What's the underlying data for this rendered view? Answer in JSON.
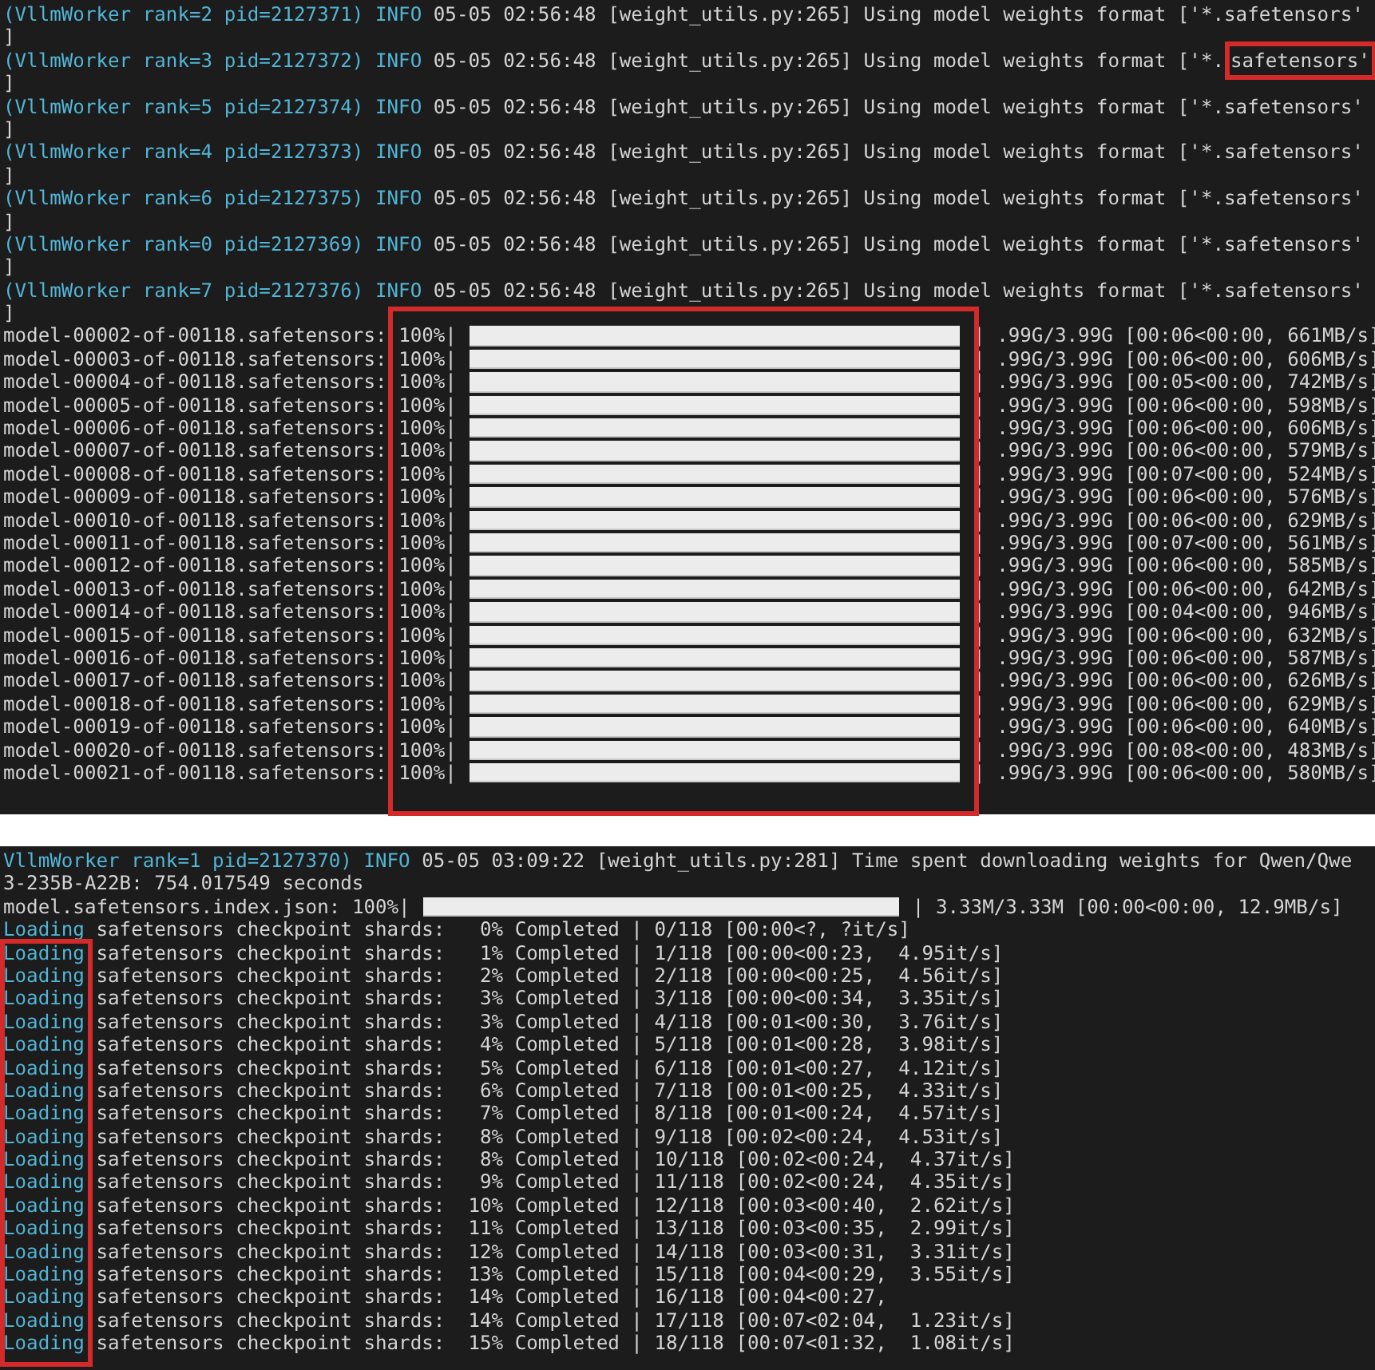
{
  "top_terminal": {
    "log_lines": [
      {
        "prefix": "(VllmWorker rank=2 pid=2127371) INFO",
        "message": "05-05 02:56:48 [weight_utils.py:265] Using model weights format ['*.safetensors'",
        "continuation": "]"
      },
      {
        "prefix": "(VllmWorker rank=3 pid=2127372) INFO",
        "message": "05-05 02:56:48 [weight_utils.py:265] Using model weights format ['*.",
        "highlight": "safetensors'",
        "continuation": "]"
      },
      {
        "prefix": "(VllmWorker rank=5 pid=2127374) INFO",
        "message": "05-05 02:56:48 [weight_utils.py:265] Using model weights format ['*.safetensors'",
        "continuation": "]"
      },
      {
        "prefix": "(VllmWorker rank=4 pid=2127373) INFO",
        "message": "05-05 02:56:48 [weight_utils.py:265] Using model weights format ['*.safetensors'",
        "continuation": "]"
      },
      {
        "prefix": "(VllmWorker rank=6 pid=2127375) INFO",
        "message": "05-05 02:56:48 [weight_utils.py:265] Using model weights format ['*.safetensors'",
        "continuation": "]"
      },
      {
        "prefix": "(VllmWorker rank=0 pid=2127369) INFO",
        "message": "05-05 02:56:48 [weight_utils.py:265] Using model weights format ['*.safetensors'",
        "continuation": "]"
      },
      {
        "prefix": "(VllmWorker rank=7 pid=2127376) INFO",
        "message": "05-05 02:56:48 [weight_utils.py:265] Using model weights format ['*.safetensors'",
        "continuation": "]"
      }
    ],
    "downloads": [
      {
        "file": "model-00002-of-00118.safetensors:",
        "percent": "100%|",
        "level": 1,
        "transfer": "| .99G/3.99G [00:06<00:00, 661MB/s]"
      },
      {
        "file": "model-00003-of-00118.safetensors:",
        "percent": "100%|",
        "level": 1,
        "transfer": "| .99G/3.99G [00:06<00:00, 606MB/s]"
      },
      {
        "file": "model-00004-of-00118.safetensors:",
        "percent": "100%|",
        "level": 1,
        "transfer": "| .99G/3.99G [00:05<00:00, 742MB/s]"
      },
      {
        "file": "model-00005-of-00118.safetensors:",
        "percent": "100%|",
        "level": 1,
        "transfer": "| .99G/3.99G [00:06<00:00, 598MB/s]"
      },
      {
        "file": "model-00006-of-00118.safetensors:",
        "percent": "100%|",
        "level": 1,
        "transfer": "| .99G/3.99G [00:06<00:00, 606MB/s]"
      },
      {
        "file": "model-00007-of-00118.safetensors:",
        "percent": "100%|",
        "level": 1,
        "transfer": "| .99G/3.99G [00:06<00:00, 579MB/s]"
      },
      {
        "file": "model-00008-of-00118.safetensors:",
        "percent": "100%|",
        "level": 1,
        "transfer": "| .99G/3.99G [00:07<00:00, 524MB/s]"
      },
      {
        "file": "model-00009-of-00118.safetensors:",
        "percent": "100%|",
        "level": 1,
        "transfer": "| .99G/3.99G [00:06<00:00, 576MB/s]"
      },
      {
        "file": "model-00010-of-00118.safetensors:",
        "percent": "100%|",
        "level": 1,
        "transfer": "| .99G/3.99G [00:06<00:00, 629MB/s]"
      },
      {
        "file": "model-00011-of-00118.safetensors:",
        "percent": "100%|",
        "level": 1,
        "transfer": "| .99G/3.99G [00:07<00:00, 561MB/s]"
      },
      {
        "file": "model-00012-of-00118.safetensors:",
        "percent": "100%|",
        "level": 1,
        "transfer": "| .99G/3.99G [00:06<00:00, 585MB/s]"
      },
      {
        "file": "model-00013-of-00118.safetensors:",
        "percent": "100%|",
        "level": 1,
        "transfer": "| .99G/3.99G [00:06<00:00, 642MB/s]"
      },
      {
        "file": "model-00014-of-00118.safetensors:",
        "percent": "100%|",
        "level": 1,
        "transfer": "| .99G/3.99G [00:04<00:00, 946MB/s]"
      },
      {
        "file": "model-00015-of-00118.safetensors:",
        "percent": "100%|",
        "level": 1,
        "transfer": "| .99G/3.99G [00:06<00:00, 632MB/s]"
      },
      {
        "file": "model-00016-of-00118.safetensors:",
        "percent": "100%|",
        "level": 1,
        "transfer": "| .99G/3.99G [00:06<00:00, 587MB/s]"
      },
      {
        "file": "model-00017-of-00118.safetensors:",
        "percent": "100%|",
        "level": 1,
        "transfer": "| .99G/3.99G [00:06<00:00, 626MB/s]"
      },
      {
        "file": "model-00018-of-00118.safetensors:",
        "percent": "100%|",
        "level": 1,
        "transfer": "| .99G/3.99G [00:06<00:00, 629MB/s]"
      },
      {
        "file": "model-00019-of-00118.safetensors:",
        "percent": "100%|",
        "level": 1,
        "transfer": "| .99G/3.99G [00:06<00:00, 640MB/s]"
      },
      {
        "file": "model-00020-of-00118.safetensors:",
        "percent": "100%|",
        "level": 1,
        "transfer": "| .99G/3.99G [00:08<00:00, 483MB/s]"
      },
      {
        "file": "model-00021-of-00118.safetensors:",
        "percent": "100%|",
        "level": 1,
        "transfer": "| .99G/3.99G [00:06<00:00, 580MB/s]"
      }
    ]
  },
  "bottom_terminal": {
    "log_line": {
      "prefix": "VllmWorker rank=1 pid=2127370) INFO",
      "message": "05-05 03:09:22 [weight_utils.py:281] Time spent downloading weights for Qwen/Qwe",
      "continuation": "3-235B-A22B: 754.017549 seconds"
    },
    "index_download": {
      "file": "model.safetensors.index.json:",
      "percent": "100%|",
      "level": 1,
      "transfer": "| 3.33M/3.33M [00:00<00:00, 12.9MB/s]"
    },
    "shards": [
      {
        "label": "Loading",
        "text": "safetensors checkpoint shards:   0% Completed | 0/118 [00:00<?, ?it/s]"
      },
      {
        "label": "Loading",
        "text": "safetensors checkpoint shards:   1% Completed | 1/118 [00:00<00:23,  4.95it/s]"
      },
      {
        "label": "Loading",
        "text": "safetensors checkpoint shards:   2% Completed | 2/118 [00:00<00:25,  4.56it/s]"
      },
      {
        "label": "Loading",
        "text": "safetensors checkpoint shards:   3% Completed | 3/118 [00:00<00:34,  3.35it/s]"
      },
      {
        "label": "Loading",
        "text": "safetensors checkpoint shards:   3% Completed | 4/118 [00:01<00:30,  3.76it/s]"
      },
      {
        "label": "Loading",
        "text": "safetensors checkpoint shards:   4% Completed | 5/118 [00:01<00:28,  3.98it/s]"
      },
      {
        "label": "Loading",
        "text": "safetensors checkpoint shards:   5% Completed | 6/118 [00:01<00:27,  4.12it/s]"
      },
      {
        "label": "Loading",
        "text": "safetensors checkpoint shards:   6% Completed | 7/118 [00:01<00:25,  4.33it/s]"
      },
      {
        "label": "Loading",
        "text": "safetensors checkpoint shards:   7% Completed | 8/118 [00:01<00:24,  4.57it/s]"
      },
      {
        "label": "Loading",
        "text": "safetensors checkpoint shards:   8% Completed | 9/118 [00:02<00:24,  4.53it/s]"
      },
      {
        "label": "Loading",
        "text": "safetensors checkpoint shards:   8% Completed | 10/118 [00:02<00:24,  4.37it/s]"
      },
      {
        "label": "Loading",
        "text": "safetensors checkpoint shards:   9% Completed | 11/118 [00:02<00:24,  4.35it/s]"
      },
      {
        "label": "Loading",
        "text": "safetensors checkpoint shards:  10% Completed | 12/118 [00:03<00:40,  2.62it/s]"
      },
      {
        "label": "Loading",
        "text": "safetensors checkpoint shards:  11% Completed | 13/118 [00:03<00:35,  2.99it/s]"
      },
      {
        "label": "Loading",
        "text": "safetensors checkpoint shards:  12% Completed | 14/118 [00:03<00:31,  3.31it/s]"
      },
      {
        "label": "Loading",
        "text": "safetensors checkpoint shards:  13% Completed | 15/118 [00:04<00:29,  3.55it/s]"
      },
      {
        "label": "Loading",
        "text": "safetensors checkpoint shards:  14% Completed | 16/118 [00:04<00:27,"
      },
      {
        "label": "Loading",
        "text": "safetensors checkpoint shards:  14% Completed | 17/118 [00:07<02:04,  1.23it/s]"
      },
      {
        "label": "Loading",
        "text": "safetensors checkpoint shards:  15% Completed | 18/118 [00:07<01:32,  1.08it/s]"
      }
    ]
  }
}
